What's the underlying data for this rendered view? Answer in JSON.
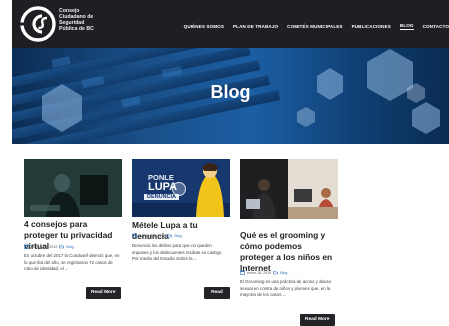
{
  "header": {
    "logo_text": "Consejo\nCiudadano de\nSeguridad\nPública de BC",
    "nav_items": [
      "QUIÉNES SOMOS",
      "PLAN DE TRABAJO",
      "COMITÉS MUNICIPALES",
      "PUBLICACIONES",
      "BLOG",
      "CONTACTO"
    ],
    "active_item": "BLOG"
  },
  "hero": {
    "title": "Blog"
  },
  "posts": [
    {
      "title": "4 consejos para proteger tu privacidad virtual",
      "date": "febrero 28, 2019",
      "category": "Blog",
      "excerpt": "En octubre del 2017 la Condusef detectó que, en lo que iba del año, se registraron 72 casos de robo de identidad, el ...",
      "button": "Read More"
    },
    {
      "title": "Métele Lupa a tu denuncia",
      "date": "febrero 21, 2019",
      "category": "Blog",
      "excerpt": "Denuncia los delitos para que no queden impunes y los delincuentes reciban su castigo. Por medio del Estudio Sobre la ...",
      "image_text": [
        "PONLE",
        "LUPA",
        "DENUNCIA"
      ],
      "button": "Read More"
    },
    {
      "title": "Qué es el grooming y cómo podemos proteger a los niños en Internet",
      "date": "enero 28, 2019",
      "category": "Blog",
      "excerpt": "El Grooming es una práctica de acoso y abuso sexual en contra de niños y jóvenes que, en la mayoría de los casos ...",
      "button": "Read More"
    }
  ],
  "icons": {
    "date": "calendar-icon",
    "category": "folder-icon"
  },
  "colors": {
    "nav_bg": "#1e1f22",
    "hero_blue": "#1b5ea3",
    "button_bg": "#222428",
    "category_link": "#2d6fb7"
  }
}
